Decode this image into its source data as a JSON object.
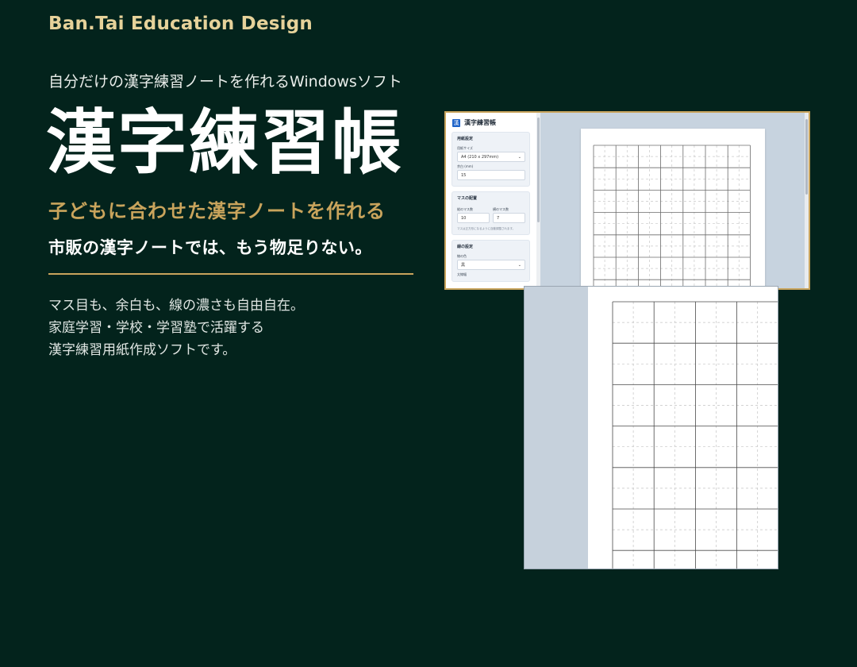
{
  "brand": "Ban.Tai Education Design",
  "tagline": "自分だけの漢字練習ノートを作れるWindowsソフト",
  "title": "漢字練習帳",
  "subtitle": "子どもに合わせた漢字ノートを作れる",
  "lead": "市販の漢字ノートでは、もう物足りない。",
  "description": [
    "マス目も、余白も、線の濃さも自由自在。",
    "家庭学習・学校・学習塾で活躍する",
    "漢字練習用紙作成ソフトです。"
  ],
  "colors": {
    "background": "#03231c",
    "gold": "#c9a45c",
    "brand": "#e6d29a"
  },
  "app": {
    "logo_glyph": "漢",
    "name": "漢字練習帳",
    "paper_settings": {
      "title": "用紙設定",
      "size_label": "用紙サイズ",
      "size_value": "A4 (210 x 297mm)",
      "margin_label": "余白 (mm)",
      "margin_value": "15"
    },
    "grid_layout": {
      "title": "マスの配置",
      "rows_label": "縦のマス数",
      "rows_value": "10",
      "cols_label": "横のマス数",
      "cols_value": "7",
      "note": "マスは正方形になるように自動調整されます。"
    },
    "line_settings": {
      "title": "線の設定",
      "color_label": "線の色",
      "color_value": "黒",
      "width_label": "太線幅"
    }
  }
}
